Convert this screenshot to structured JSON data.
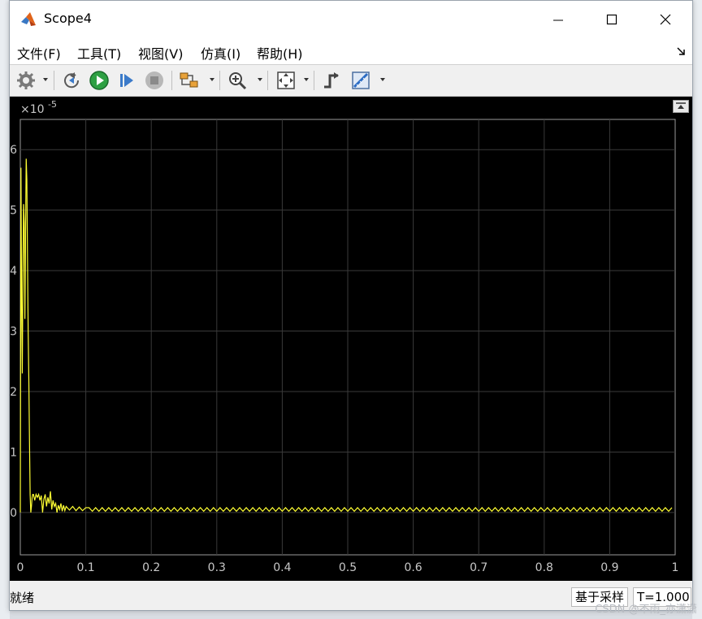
{
  "window": {
    "title": "Scope4"
  },
  "menu": [
    {
      "label": "文件(F)"
    },
    {
      "label": "工具(T)"
    },
    {
      "label": "视图(V)"
    },
    {
      "label": "仿真(I)"
    },
    {
      "label": "帮助(H)"
    }
  ],
  "toolbar": {
    "icons": [
      "gear-icon",
      "step-back-icon",
      "run-icon",
      "step-forward-icon",
      "stop-icon",
      "highlight-block-icon",
      "zoom-icon",
      "fit-to-view-icon",
      "triggers-icon",
      "measurements-icon"
    ]
  },
  "status": {
    "text": "就绪",
    "sample_mode": "基于采样",
    "time": "T=1.000"
  },
  "watermark": "CSDN @不雨_亦潇潇",
  "colors": {
    "signal": "#ffff33",
    "plot_bg": "#000000",
    "grid": "#3a3a3a"
  },
  "chart_data": {
    "type": "line",
    "exponent_label": "×10",
    "exponent_power": "-5",
    "x_ticks": [
      "0",
      "0.1",
      "0.2",
      "0.3",
      "0.4",
      "0.5",
      "0.6",
      "0.7",
      "0.8",
      "0.9",
      "1"
    ],
    "y_ticks": [
      "0",
      "1",
      "2",
      "3",
      "4",
      "5",
      "6"
    ],
    "xlim": [
      0,
      1
    ],
    "ylim": [
      -0.7,
      6.5
    ],
    "grid": true,
    "series": [
      {
        "x": [
          0,
          0.001,
          0.002,
          0.003,
          0.004,
          0.005,
          0.006,
          0.007,
          0.008,
          0.009,
          0.01,
          0.011,
          0.012,
          0.013,
          0.014,
          0.015,
          0.016,
          0.017,
          0.018,
          0.019,
          0.02,
          0.022,
          0.024,
          0.026,
          0.028,
          0.03,
          0.032,
          0.034,
          0.036,
          0.038,
          0.04,
          0.042,
          0.044,
          0.046,
          0.048,
          0.05,
          0.052,
          0.054,
          0.056,
          0.058,
          0.06,
          0.062,
          0.064,
          0.066,
          0.068,
          0.07,
          0.075,
          0.08,
          0.085,
          0.09,
          0.095,
          0.1
        ],
        "y": [
          0,
          5.7,
          3.5,
          2.3,
          4.0,
          5.1,
          4.8,
          3.2,
          4.6,
          5.85,
          5.5,
          4.2,
          3.0,
          2.2,
          1.2,
          0.3,
          0.0,
          0.1,
          0.25,
          0.3,
          0.3,
          0.2,
          0.3,
          0.25,
          0.3,
          0.2,
          0.28,
          0.0,
          0.22,
          0.3,
          0.1,
          0.25,
          0.15,
          0.35,
          0.05,
          0.2,
          0.1,
          0.15,
          0.0,
          0.12,
          0.05,
          0.15,
          0.02,
          0.12,
          0.03,
          0.1,
          0.04,
          0.1,
          0.03,
          0.09,
          0.03,
          0.08
        ]
      }
    ],
    "steady_state": {
      "x_start": 0.1,
      "x_end": 1.0,
      "low": 0.02,
      "high": 0.08,
      "period": 0.01
    }
  }
}
